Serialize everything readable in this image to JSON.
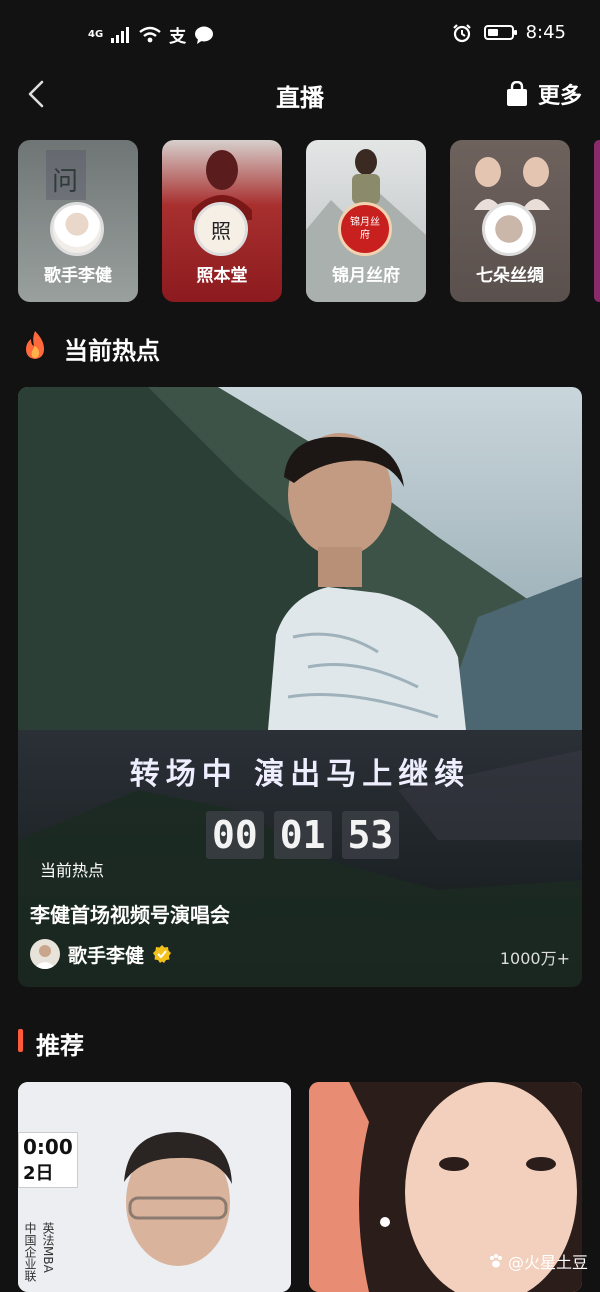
{
  "status_bar": {
    "network": "4G",
    "extra_glyph": "支",
    "time": "8:45",
    "battery_level": 0.45
  },
  "header": {
    "back_icon": "chevron-left-icon",
    "title": "直播",
    "more_label": "更多",
    "more_icon": "shopping-bag-icon"
  },
  "stories": [
    {
      "label": "歌手李健",
      "bg": "#8a8f8f"
    },
    {
      "label": "照本堂",
      "bg": "#8c1a1e",
      "avatar_text": "照"
    },
    {
      "label": "锦月丝府",
      "bg": "#cfd3d3",
      "avatar_text": "锦月丝府"
    },
    {
      "label": "七朵丝绸",
      "bg": "#6b5e5a"
    }
  ],
  "hot_section": {
    "title": "当前热点",
    "icon": "fire-icon",
    "accent": "#ff6a3d"
  },
  "hero": {
    "transition_text": "转场中 演出马上继续",
    "countdown": {
      "h": "00",
      "m": "01",
      "s": "53"
    },
    "tag": "当前热点",
    "title": "李健首场视频号演唱会",
    "author": "歌手李健",
    "verified_icon": "verified-badge-icon",
    "viewers": "1000万+"
  },
  "recommend_section": {
    "title": "推荐",
    "accent": "#ff5a3c"
  },
  "recommend_cards": [
    {
      "badge_time": "0:00",
      "badge_date": "2日",
      "side_text": "中国企业联",
      "side_text2": "英法MBA"
    },
    {}
  ],
  "watermark": "@火星土豆"
}
